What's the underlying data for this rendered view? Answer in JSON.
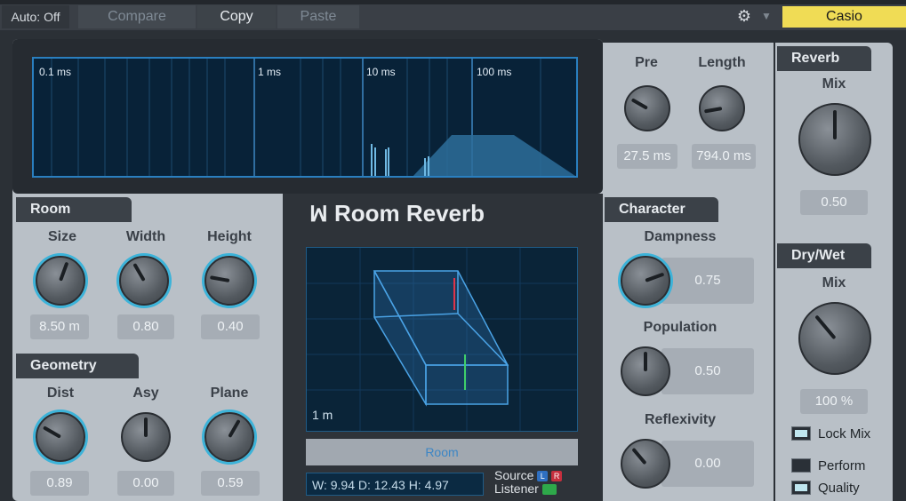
{
  "toolbar": {
    "auto": "Auto: Off",
    "compare": "Compare",
    "copy": "Copy",
    "paste": "Paste",
    "preset": "Casio"
  },
  "display": {
    "scale_labels": [
      "0.1 ms",
      "1 ms",
      "10 ms",
      "100 ms"
    ]
  },
  "room": {
    "header": "Room",
    "size": {
      "label": "Size",
      "value": "8.50 m"
    },
    "width": {
      "label": "Width",
      "value": "0.80"
    },
    "height": {
      "label": "Height",
      "value": "0.40"
    }
  },
  "geometry": {
    "header": "Geometry",
    "dist": {
      "label": "Dist",
      "value": "0.89"
    },
    "asy": {
      "label": "Asy",
      "value": "0.00"
    },
    "plane": {
      "label": "Plane",
      "value": "0.59"
    }
  },
  "center": {
    "logo": "Room Reverb",
    "scale": "1 m",
    "room_button": "Room",
    "dims": "W:  9.94  D: 12.43 H:  4.97",
    "source": "Source",
    "listener": "Listener",
    "l_tag": "L",
    "r_tag": "R"
  },
  "predelay": {
    "pre": {
      "label": "Pre",
      "value": "27.5 ms"
    },
    "length": {
      "label": "Length",
      "value": "794.0 ms"
    }
  },
  "character": {
    "header": "Character",
    "dampness": {
      "label": "Dampness",
      "value": "0.75"
    },
    "population": {
      "label": "Population",
      "value": "0.50"
    },
    "reflexivity": {
      "label": "Reflexivity",
      "value": "0.00"
    }
  },
  "reverb": {
    "header": "Reverb",
    "mix_label": "Mix",
    "mix_value": "0.50"
  },
  "drywet": {
    "header": "Dry/Wet",
    "mix_label": "Mix",
    "mix_value": "100 %",
    "lock_mix": "Lock Mix",
    "perform": "Perform",
    "quality": "Quality"
  },
  "colors": {
    "accent": "#3cb3d9",
    "preset_bg": "#f0dc55",
    "display_line": "#2a7fbf"
  }
}
